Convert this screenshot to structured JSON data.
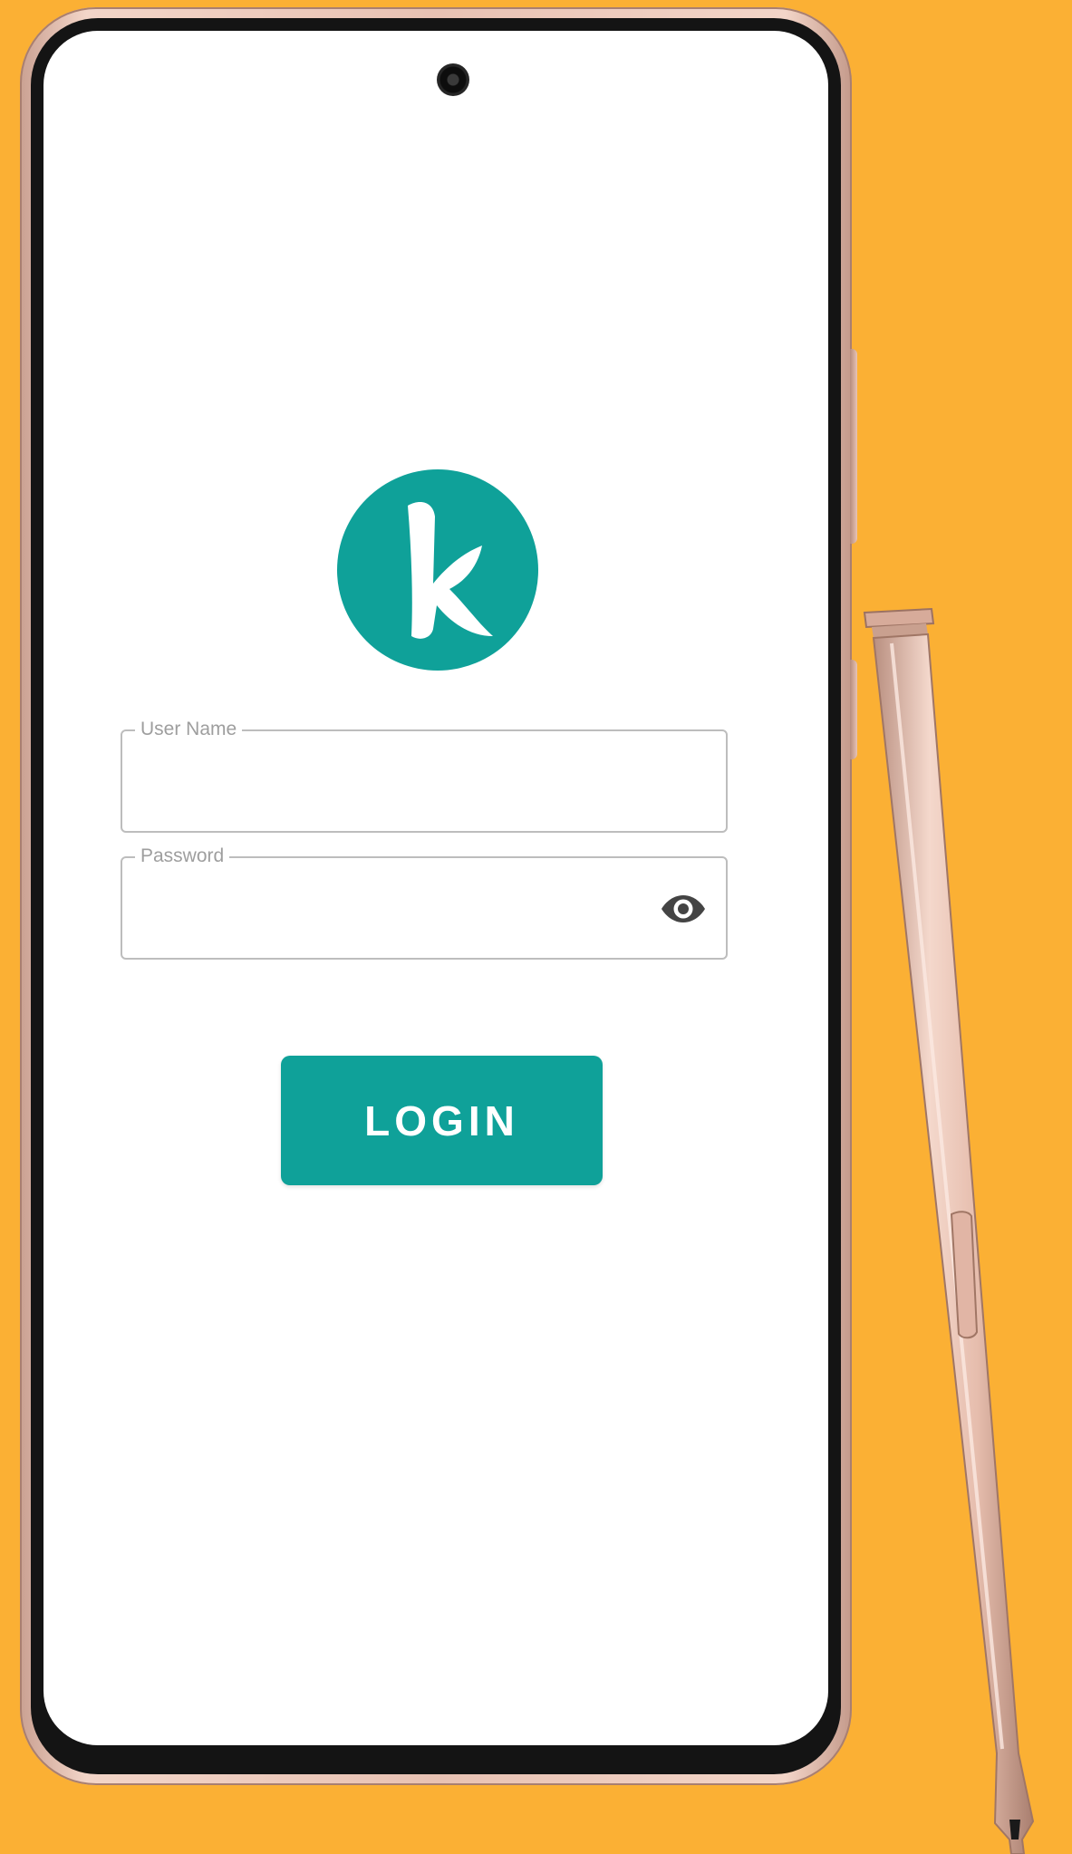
{
  "form": {
    "username_label": "User Name",
    "username_value": "",
    "password_label": "Password",
    "password_value": ""
  },
  "login_button": {
    "label": "LOGIN"
  },
  "icons": {
    "logo": "k-logo-icon",
    "visibility": "eye-icon",
    "camera": "front-camera-icon"
  },
  "colors": {
    "background": "#FBB034",
    "accent": "#0FA199",
    "phone_frame": "#E8C2B3",
    "field_border": "#BDBDBD",
    "label_text": "#9E9E9E"
  }
}
